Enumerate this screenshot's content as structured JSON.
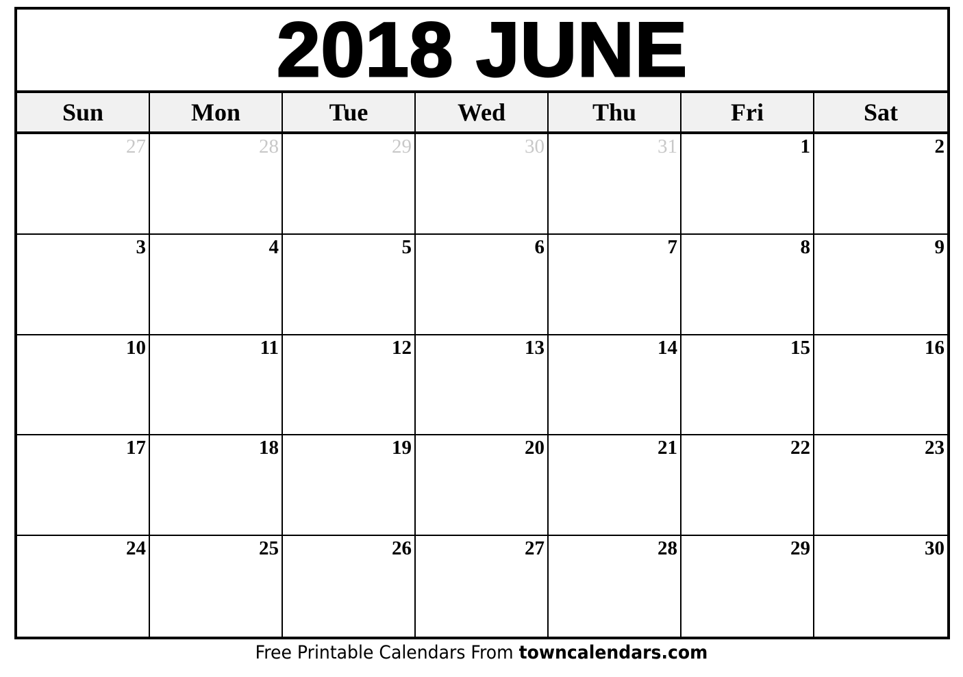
{
  "calendar": {
    "title": "2018 JUNE",
    "weekdays": [
      "Sun",
      "Mon",
      "Tue",
      "Wed",
      "Thu",
      "Fri",
      "Sat"
    ],
    "weeks": [
      [
        {
          "day": "27",
          "other": true
        },
        {
          "day": "28",
          "other": true
        },
        {
          "day": "29",
          "other": true
        },
        {
          "day": "30",
          "other": true
        },
        {
          "day": "31",
          "other": true
        },
        {
          "day": "1",
          "other": false
        },
        {
          "day": "2",
          "other": false
        }
      ],
      [
        {
          "day": "3",
          "other": false
        },
        {
          "day": "4",
          "other": false
        },
        {
          "day": "5",
          "other": false
        },
        {
          "day": "6",
          "other": false
        },
        {
          "day": "7",
          "other": false
        },
        {
          "day": "8",
          "other": false
        },
        {
          "day": "9",
          "other": false
        }
      ],
      [
        {
          "day": "10",
          "other": false
        },
        {
          "day": "11",
          "other": false
        },
        {
          "day": "12",
          "other": false
        },
        {
          "day": "13",
          "other": false
        },
        {
          "day": "14",
          "other": false
        },
        {
          "day": "15",
          "other": false
        },
        {
          "day": "16",
          "other": false
        }
      ],
      [
        {
          "day": "17",
          "other": false
        },
        {
          "day": "18",
          "other": false
        },
        {
          "day": "19",
          "other": false
        },
        {
          "day": "20",
          "other": false
        },
        {
          "day": "21",
          "other": false
        },
        {
          "day": "22",
          "other": false
        },
        {
          "day": "23",
          "other": false
        }
      ],
      [
        {
          "day": "24",
          "other": false
        },
        {
          "day": "25",
          "other": false
        },
        {
          "day": "26",
          "other": false
        },
        {
          "day": "27",
          "other": false
        },
        {
          "day": "28",
          "other": false
        },
        {
          "day": "29",
          "other": false
        },
        {
          "day": "30",
          "other": false
        }
      ]
    ]
  },
  "footer": {
    "prefix": "Free Printable Calendars From ",
    "site": "towncalendars.com"
  },
  "colors": {
    "header_bg": "#f1f1f1",
    "other_month_day": "#c8c8c8"
  }
}
